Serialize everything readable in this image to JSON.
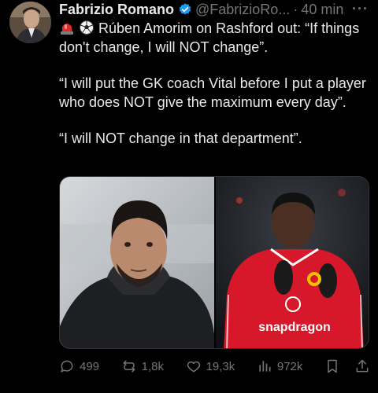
{
  "tweet": {
    "author_name": "Fabrizio Romano",
    "handle": "@FabrizioRo...",
    "separator": "·",
    "time": "40 min",
    "more_label": "···",
    "paragraphs": [
      "Rúben Amorim on Rashford out: “If things don't change, I will NOT change”.",
      "“I will put the GK coach Vital before I put a player who does NOT give the maximum every day”.",
      "“I will NOT change in that department”."
    ],
    "emojis": [
      "rotating-light-emoji",
      "soccer-ball-emoji"
    ]
  },
  "media": {
    "sponsor_text": "snapdragon"
  },
  "actions": {
    "replies": "499",
    "reposts": "1,8k",
    "likes": "19,3k",
    "views": "972k"
  },
  "colors": {
    "background": "#000000",
    "text": "#e7e9ea",
    "muted": "#71767b",
    "verified": "#1d9bf0",
    "kit_red": "#d7172a"
  }
}
